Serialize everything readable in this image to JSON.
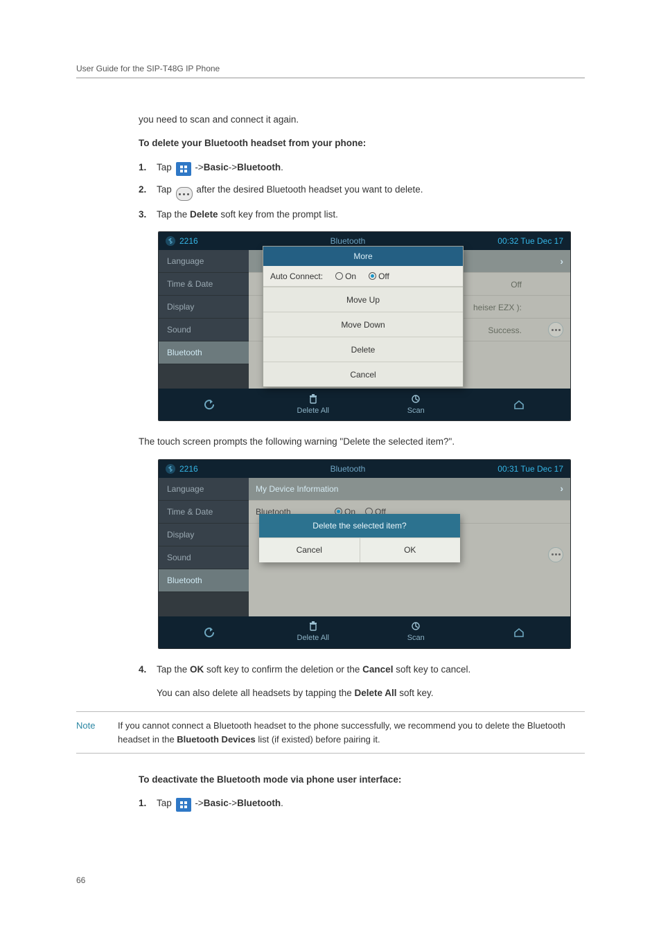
{
  "page": {
    "running_head": "User Guide for the SIP-T48G IP Phone",
    "page_number": "66"
  },
  "intro_para": "you need to scan and connect it again.",
  "delete_heading": "To delete your Bluetooth headset from your phone:",
  "step1": {
    "num": "1.",
    "prefix": "Tap",
    "navpath_basic": "Basic",
    "navpath_bt": "Bluetooth",
    "arrow": "->",
    "dot": "."
  },
  "step2": {
    "num": "2.",
    "prefix": "Tap",
    "suffix": "after the desired Bluetooth headset you want to delete."
  },
  "step3": {
    "num": "3.",
    "text_a": "Tap the ",
    "text_b": "Delete",
    "text_c": " soft key from the prompt list."
  },
  "shot1": {
    "ext": "2216",
    "title": "Bluetooth",
    "clock": "00:32 Tue Dec 17",
    "sidebar": [
      "Language",
      "Time & Date",
      "Display",
      "Sound",
      "Bluetooth"
    ],
    "right_top_off": "Off",
    "right_row2": "heiser EZX ):",
    "right_row3": "Success.",
    "menu_head": "More",
    "menu_auto_label": "Auto Connect:",
    "menu_on": "On",
    "menu_off": "Off",
    "menu_moveup": "Move Up",
    "menu_movedown": "Move Down",
    "menu_delete": "Delete",
    "menu_cancel": "Cancel",
    "footer_delete_all": "Delete All",
    "footer_scan": "Scan"
  },
  "between_shots": "The touch screen prompts the following warning \"Delete the selected item?\".",
  "shot2": {
    "ext": "2216",
    "title": "Bluetooth",
    "clock": "00:31 Tue Dec 17",
    "sidebar": [
      "Language",
      "Time & Date",
      "Display",
      "Sound",
      "Bluetooth"
    ],
    "row1_label": "My Device Information",
    "row2_label": "Bluetooth",
    "row2_on": "On",
    "row2_off": "Off",
    "dialog_head": "Delete the selected item?",
    "dialog_cancel": "Cancel",
    "dialog_ok": "OK",
    "footer_delete_all": "Delete All",
    "footer_scan": "Scan"
  },
  "step4": {
    "num": "4.",
    "a": "Tap the ",
    "b": "OK",
    "c": " soft key to confirm the deletion or the ",
    "d": "Cancel",
    "e": " soft key to cancel."
  },
  "post_step4": {
    "a": "You can also delete all headsets by tapping the ",
    "b": "Delete All",
    "c": " soft key."
  },
  "note": {
    "label": "Note",
    "body_a": "If you cannot connect a Bluetooth headset to the phone successfully, we recommend you to delete the Bluetooth headset in the ",
    "body_b": "Bluetooth Devices",
    "body_c": " list (if existed) before pairing it."
  },
  "deactivate_heading": "To deactivate the Bluetooth mode via phone user interface:",
  "deact_step1": {
    "num": "1.",
    "prefix": "Tap",
    "navpath_basic": "Basic",
    "navpath_bt": "Bluetooth",
    "arrow": "->",
    "dot": "."
  }
}
